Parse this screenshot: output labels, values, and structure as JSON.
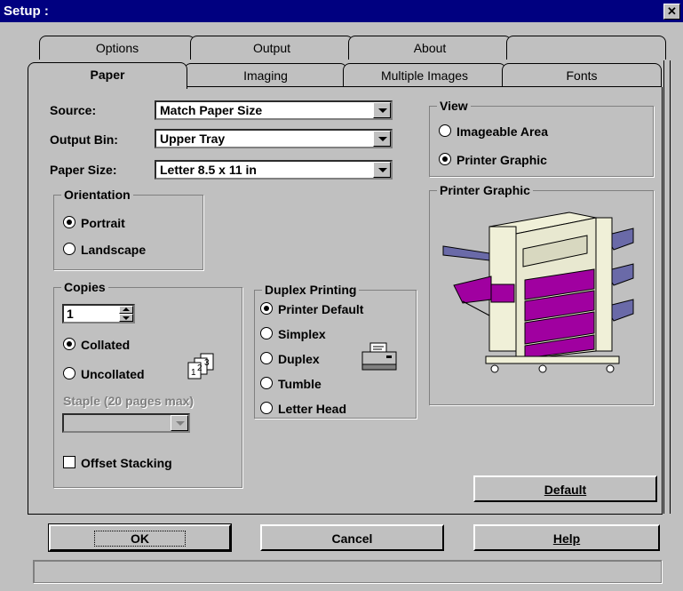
{
  "window": {
    "title": "Setup :"
  },
  "tabs_back": [
    "Options",
    "Output",
    "About",
    ""
  ],
  "tabs_front": [
    "Paper",
    "Imaging",
    "Multiple Images",
    "Fonts"
  ],
  "fields": {
    "source": {
      "label": "Source:",
      "value": "Match Paper Size"
    },
    "output_bin": {
      "label": "Output Bin:",
      "value": "Upper Tray"
    },
    "paper_size": {
      "label": "Paper Size:",
      "value": "Letter 8.5 x 11 in"
    }
  },
  "orientation": {
    "title": "Orientation",
    "portrait": "Portrait",
    "landscape": "Landscape",
    "selected": "Portrait"
  },
  "copies": {
    "title": "Copies",
    "value": "1",
    "collated": "Collated",
    "uncollated": "Uncollated",
    "selected": "Collated",
    "staple_label": "Staple (20 pages max)",
    "staple_value": "",
    "offset_stacking": "Offset Stacking"
  },
  "duplex": {
    "title": "Duplex Printing",
    "options": [
      "Printer Default",
      "Simplex",
      "Duplex",
      "Tumble",
      "Letter Head"
    ],
    "selected": "Printer Default"
  },
  "view": {
    "title": "View",
    "imageable": "Imageable Area",
    "printer_graphic": "Printer Graphic",
    "selected": "Printer Graphic"
  },
  "printer_graphic": {
    "title": "Printer Graphic",
    "accent": "#a000a0"
  },
  "buttons": {
    "default": "Default",
    "ok": "OK",
    "cancel": "Cancel",
    "help": "Help"
  },
  "status": ""
}
